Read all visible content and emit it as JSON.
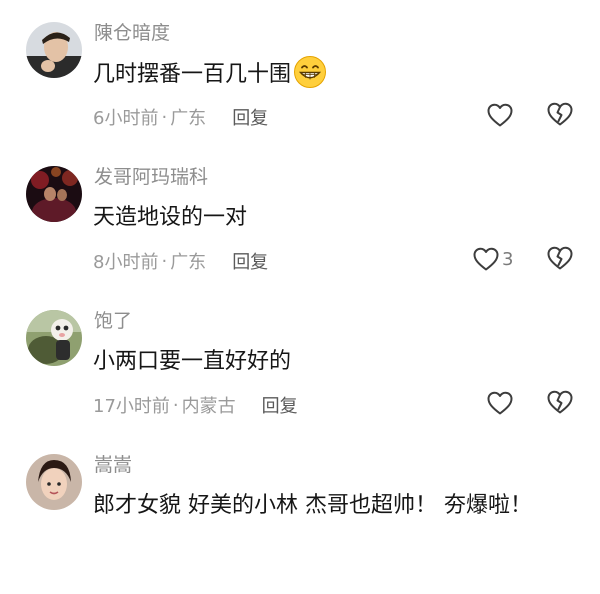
{
  "comments": [
    {
      "username": "陳仓暗度",
      "text": "几时摆番一百几十围",
      "emoji": "grinning-face-emoji",
      "time": "6小时前",
      "location": "广东",
      "reply_label": "回复",
      "like_count": ""
    },
    {
      "username": "发哥阿玛瑞科",
      "text": "天造地设的一对",
      "time": "8小时前",
      "location": "广东",
      "reply_label": "回复",
      "like_count": "3"
    },
    {
      "username": "饱了",
      "text": "小两口要一直好好的",
      "time": "17小时前",
      "location": "内蒙古",
      "reply_label": "回复",
      "like_count": ""
    },
    {
      "username": "嵩嵩",
      "text": "郎才女貌 好美的小林 杰哥也超帅！ 夯爆啦！"
    }
  ],
  "meta_separator": "·",
  "icons": {
    "like": "heart-outline-icon",
    "dislike": "broken-heart-outline-icon"
  },
  "colors": {
    "username": "#8d8d8d",
    "meta": "#9a9a9a",
    "text": "#161616",
    "reply": "#5a5a5a"
  }
}
